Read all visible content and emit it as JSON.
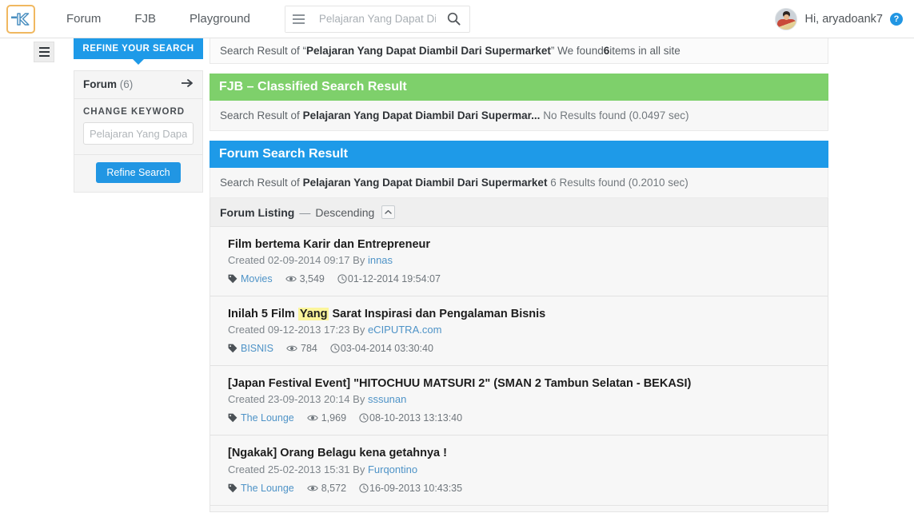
{
  "header": {
    "logo_alt": "kaskus-logo",
    "nav": [
      {
        "label": "Forum",
        "name": "nav-forum"
      },
      {
        "label": "FJB",
        "name": "nav-fjb"
      },
      {
        "label": "Playground",
        "name": "nav-playground"
      }
    ],
    "search": {
      "value": "Pelajaran Yang Dapat Diambil",
      "placeholder": "Pelajaran Yang Dapat Diambil",
      "menu_icon": "hamburger-icon",
      "submit_icon": "search-icon"
    },
    "user": {
      "greeting": "Hi, aryadoank7",
      "help_label": "?",
      "avatar_name": "user-avatar"
    }
  },
  "result_strip": {
    "prefix": "Search Result of “",
    "query": "Pelajaran Yang Dapat Diambil Dari Supermarket",
    "middle": "” We found ",
    "count": "6",
    "suffix": " items in all site"
  },
  "sidebar": {
    "tab_label": "REFINE YOUR SEARCH",
    "forum_row": {
      "label": "Forum",
      "count": "(6)",
      "arrow_icon": "arrow-right-icon"
    },
    "change_keyword_title": "CHANGE KEYWORD",
    "keyword_value": "Pelajaran Yang Dapat Diambil Dari Supermarket",
    "keyword_placeholder": "Pelajaran Yang Dapa",
    "refine_button": "Refine Search"
  },
  "fjb_block": {
    "heading": "FJB – Classified Search Result",
    "sub_prefix": "Search Result of ",
    "sub_query": "Pelajaran Yang Dapat Diambil Dari Supermar...",
    "sub_status": "No Results found (0.0497 sec)",
    "accent_color": "#7ed06b"
  },
  "forum_block": {
    "heading": "Forum Search Result",
    "sub_prefix": "Search Result of ",
    "sub_query": "Pelajaran Yang Dapat Diambil Dari Supermarket",
    "sub_status": "6 Results found (0.2010 sec)",
    "accent_color": "#1e9ae8",
    "listing_label": "Forum Listing",
    "listing_dash": "—",
    "listing_order": "Descending",
    "sort_icon": "chevron-up-icon"
  },
  "results": [
    {
      "title_before": "Film bertema Karir dan Entrepreneur",
      "highlight": "",
      "title_after": "",
      "created_label": "Created",
      "created_at": "02-09-2014 09:17",
      "by_label": "By",
      "author": "innas",
      "tag": "Movies",
      "views": "3,549",
      "last_post": "01-12-2014 19:54:07"
    },
    {
      "title_before": "Inilah 5 Film ",
      "highlight": "Yang",
      "title_after": " Sarat Inspirasi dan Pengalaman Bisnis",
      "created_label": "Created",
      "created_at": "09-12-2013 17:23",
      "by_label": "By",
      "author": "eCIPUTRA.com",
      "tag": "BISNIS",
      "views": "784",
      "last_post": "03-04-2014 03:30:40"
    },
    {
      "title_before": "[Japan Festival Event] \"HITOCHUU MATSURI 2\" (SMAN 2 Tambun Selatan - BEKASI)",
      "highlight": "",
      "title_after": "",
      "created_label": "Created",
      "created_at": "23-09-2013 20:14",
      "by_label": "By",
      "author": "sssunan",
      "tag": "The Lounge",
      "views": "1,969",
      "last_post": "08-10-2013 13:13:40"
    },
    {
      "title_before": "[Ngakak] Orang Belagu kena getahnya !",
      "highlight": "",
      "title_after": "",
      "created_label": "Created",
      "created_at": "25-02-2013 15:31",
      "by_label": "By",
      "author": "Furqontino",
      "tag": "The Lounge",
      "views": "8,572",
      "last_post": "16-09-2013 10:43:35"
    }
  ],
  "icons": {
    "tag": "tag-icon",
    "eye": "eye-icon",
    "clock": "clock-icon"
  }
}
